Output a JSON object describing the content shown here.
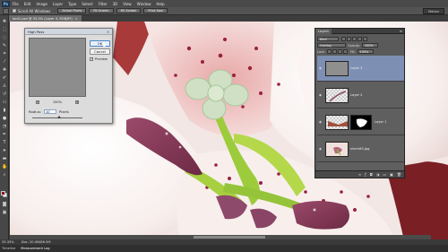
{
  "app": {
    "logo": "Ps",
    "menus": [
      "File",
      "Edit",
      "Image",
      "Layer",
      "Type",
      "Select",
      "Filter",
      "3D",
      "View",
      "Window",
      "Help"
    ],
    "workspace": "Motion"
  },
  "options_bar": {
    "checkbox_label": "Scroll All Windows",
    "buttons": [
      "Actual Pixels",
      "Fit Screen",
      "Fill Screen",
      "Print Size"
    ]
  },
  "document": {
    "tab_title": "lant1.psd @ 33.3% (Layer 3, RGB/8*)"
  },
  "status": {
    "zoom": "33.33%",
    "doc_size": "Doc: 20.0M/86.5M",
    "bottom_tabs": [
      "Timeline",
      "Measurement Log"
    ]
  },
  "high_pass": {
    "title": "High Pass",
    "ok_label": "OK",
    "cancel_label": "Cancel",
    "preview_label": "Preview",
    "preview_checked": "✓",
    "zoom_level": "100%",
    "zoom_out": "−",
    "zoom_in": "+",
    "radius_label": "Radius:",
    "radius_value": "10",
    "radius_unit": "Pixels"
  },
  "layers_panel": {
    "tab": "Layers",
    "filter_value": "Kind",
    "blend_mode": "Overlay",
    "opacity_label": "Opacity:",
    "opacity_value": "100%",
    "lock_label": "Lock:",
    "fill_label": "Fill:",
    "fill_value": "100%",
    "layers": [
      {
        "name": "Layer 3"
      },
      {
        "name": "Layer 2"
      },
      {
        "name": "Layer 1"
      },
      {
        "name": "ntech65.jpg"
      }
    ]
  }
}
